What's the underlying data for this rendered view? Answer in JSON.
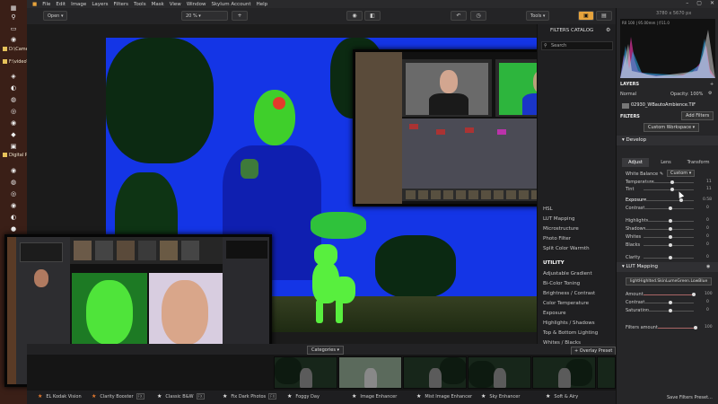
{
  "taskbar": {
    "folders": [
      "D:\\Came...",
      "F:\\video\\...",
      "Digital P..."
    ]
  },
  "menubar": {
    "items": [
      "File",
      "Edit",
      "Image",
      "Layers",
      "Filters",
      "Tools",
      "Mask",
      "View",
      "Window",
      "Skylum Account",
      "Help"
    ]
  },
  "toolbar": {
    "open_label": "Open",
    "zoom_label": "20 %",
    "tools_label": "Tools"
  },
  "catalog": {
    "title": "FILTERS CATALOG",
    "search_placeholder": "Search",
    "items_upper": [
      "HSL",
      "LUT Mapping",
      "Microstructure",
      "Photo Filter",
      "Split Color Warmth"
    ],
    "utility_heading": "UTILITY",
    "items_utility": [
      "Adjustable Gradient",
      "Bi-Color Toning",
      "Brightness / Contrast",
      "Color Temperature",
      "Exposure",
      "Highlights / Shadows",
      "Top & Bottom Lighting",
      "Whites / Blacks"
    ]
  },
  "bottom": {
    "categories_label": "Categories",
    "overlay_preset_label": "+ Overlay Preset",
    "tag": "FX",
    "films": [
      {
        "label": "EL Kodak Vision",
        "fav": true
      },
      {
        "label": "Clarity Booster",
        "fav": true
      },
      {
        "label": "Classic B&W",
        "fav": false
      },
      {
        "label": "Fix Dark Photos",
        "fav": false
      },
      {
        "label": "Foggy Day",
        "fav": false
      },
      {
        "label": "Image Enhancer",
        "fav": false
      },
      {
        "label": "Mist Image Enhancer",
        "fav": false
      },
      {
        "label": "Sky Enhancer",
        "fav": false
      },
      {
        "label": "Soft & Airy",
        "fav": false
      }
    ]
  },
  "right": {
    "histogram_info": "3780 x 5670 px",
    "histogram_values": "R0 100 | 95.00mm | f/11.0",
    "layers_label": "LAYERS",
    "layer_mode": "Normal",
    "opacity_label": "Opacity: 100%",
    "layer_name": "02930_WBautoAmbience.TIF",
    "filters_label": "FILTERS",
    "add_filters_label": "Add Filters",
    "workspace_label": "Custom Workspace",
    "develop_label": "Develop",
    "tabs": [
      "Adjust",
      "Lens",
      "Transform"
    ],
    "white_balance_label": "White Balance",
    "white_balance_value": "Custom",
    "temperature_label": "Temperature",
    "temperature_value": "11",
    "tint_label": "Tint",
    "tint_value": "11",
    "exposure_label": "Exposure",
    "exposure_value": "0.58",
    "contrast_label": "Contrast",
    "contrast_value": "0",
    "highlights_label": "Highlights",
    "highlights_value": "0",
    "shadows_label": "Shadows",
    "shadows_value": "0",
    "whites_label": "Whites",
    "whites_value": "0",
    "blacks_label": "Blacks",
    "blacks_value": "0",
    "clarity_label": "Clarity",
    "clarity_value": "0",
    "lut_label": "LUT Mapping",
    "lut_file": "lightHighlted.SkinLumeGreen.LowBlue",
    "amount_label": "Amount",
    "amount_value": "100",
    "lut_contrast_label": "Contrast",
    "lut_contrast_value": "0",
    "saturation_label": "Saturation",
    "saturation_value": "0",
    "filters_amount_label": "Filters amount",
    "filters_amount_value": "100",
    "save_preset_label": "Save Filters Preset..."
  },
  "colors": {
    "mask_blue": "#1435e6",
    "mask_green": "#3fcf2b",
    "accent_orange": "#e67a2e"
  }
}
